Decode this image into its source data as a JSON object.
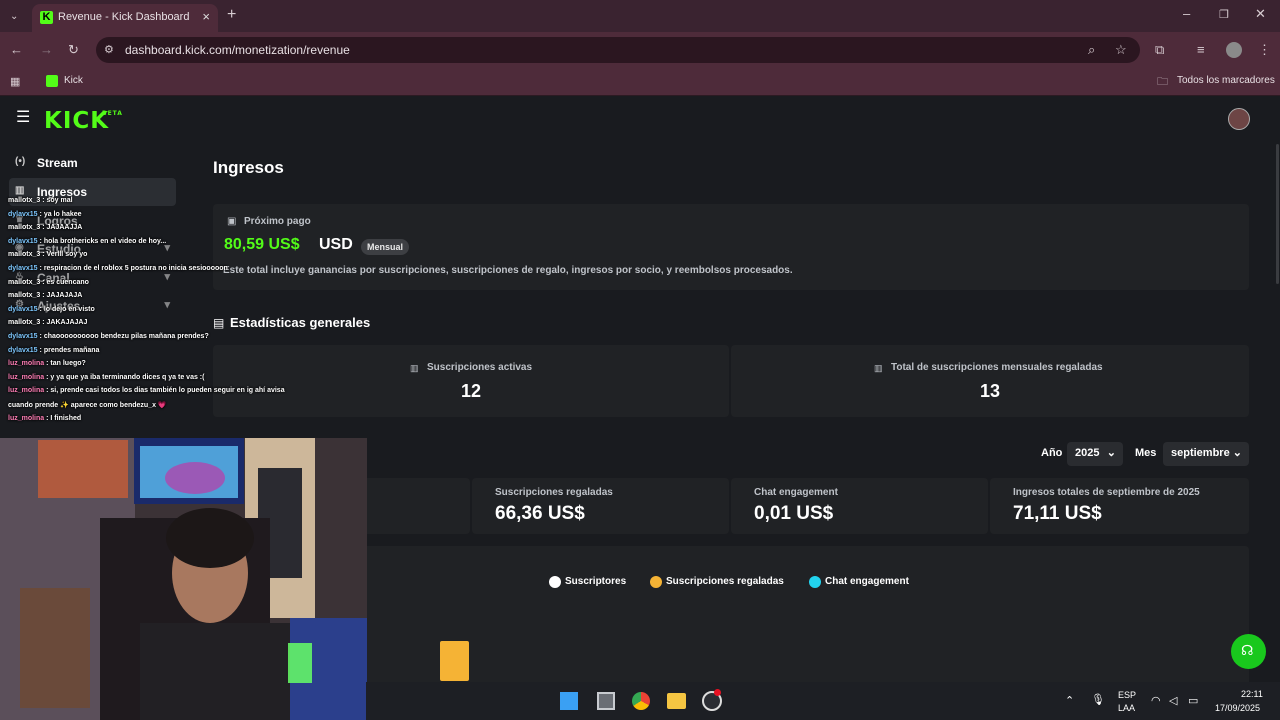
{
  "browser": {
    "tab_title": "Revenue - Kick Dashboard",
    "url": "dashboard.kick.com/monetization/revenue",
    "bookmark": "Kick",
    "all_bookmarks": "Todos los marcadores"
  },
  "app": {
    "logo": "KICK",
    "logo_badge": "BETA"
  },
  "sidebar": {
    "items": [
      {
        "label": "Stream",
        "icon": "broadcast-icon"
      },
      {
        "label": "Ingresos",
        "icon": "chart-icon",
        "active": true
      },
      {
        "label": "Logros",
        "icon": "trophy-icon"
      },
      {
        "label": "Estudio",
        "icon": "studio-icon"
      },
      {
        "label": "Canal",
        "icon": "channel-icon"
      },
      {
        "label": "Ajustes",
        "icon": "gear-icon"
      }
    ]
  },
  "main": {
    "title": "Ingresos",
    "next_payment": {
      "label": "Próximo pago",
      "amount": "80,59 US$",
      "currency": "USD",
      "badge": "Mensual",
      "note": "Este total incluye ganancias por suscripciones, suscripciones de regalo, ingresos por socio, y reembolsos procesados."
    },
    "general_stats_title": "Estadísticas generales",
    "stats": [
      {
        "label": "Suscripciones activas",
        "value": "12"
      },
      {
        "label": "Total de suscripciones mensuales regaladas",
        "value": "13"
      }
    ],
    "filters": {
      "year_label": "Año",
      "year_value": "2025",
      "month_label": "Mes",
      "month_value": "septiembre"
    },
    "revenue_cards": [
      {
        "label": "Suscripciones regaladas",
        "value": "66,36 US$"
      },
      {
        "label": "Chat engagement",
        "value": "0,01 US$"
      },
      {
        "label": "Ingresos totales de septiembre de 2025",
        "value": "71,11 US$"
      }
    ],
    "legend": [
      {
        "label": "Suscriptores",
        "color": "#ffffff"
      },
      {
        "label": "Suscripciones regaladas",
        "color": "#f5b335"
      },
      {
        "label": "Chat engagement",
        "color": "#22d3ee"
      }
    ]
  },
  "chat": [
    {
      "user": "mallotx_3",
      "text": ": soy mal",
      "color": "#ffffff"
    },
    {
      "user": "dylavx15",
      "text": ": ya lo hakee",
      "color": "#7ec8ff"
    },
    {
      "user": "mallotx_3",
      "text": ": JAJAAJJA",
      "color": "#ffffff"
    },
    {
      "user": "dylavx15",
      "text": ": hola brothericks en el video de hoy...",
      "color": "#7ec8ff"
    },
    {
      "user": "mallotx_3",
      "text": ": Verlll soy yo",
      "color": "#ffffff"
    },
    {
      "user": "dylavx15",
      "text": ": respiracion de el roblox 5 postura no inicia sesiooooon",
      "color": "#7ec8ff"
    },
    {
      "user": "mallotx_3",
      "text": ": es cuencano",
      "color": "#ffffff"
    },
    {
      "user": "mallotx_3",
      "text": ": JAJAJAJA",
      "color": "#ffffff"
    },
    {
      "user": "dylavx15",
      "text": ": lo dejo en visto",
      "color": "#7ec8ff"
    },
    {
      "user": "mallotx_3",
      "text": ": JAKAJAJAJ",
      "color": "#ffffff"
    },
    {
      "user": "dylavx15",
      "text": ": chaoooooooooo bendezu pilas mañana prendes?",
      "color": "#7ec8ff"
    },
    {
      "user": "dylavx15",
      "text": ": prendes mañana",
      "color": "#7ec8ff"
    },
    {
      "user": "luz_molina",
      "text": ": tan luego?",
      "color": "#ff7eb6"
    },
    {
      "user": "luz_molina",
      "text": ": y ya que ya iba terminando dices q ya te vas :(",
      "color": "#ff7eb6"
    },
    {
      "user": "luz_molina",
      "text": ": si, prende casi todos los dias también lo pueden seguir en ig ahí avisa",
      "color": "#ff7eb6"
    },
    {
      "user": "",
      "text": "cuando prende ✨ aparece como bendezu_x 💗",
      "color": "#ffffff"
    },
    {
      "user": "luz_molina",
      "text": ": I finished",
      "color": "#ff7eb6"
    }
  ],
  "taskbar": {
    "lang_top": "ESP",
    "lang_bottom": "LAA",
    "time": "22:11",
    "date": "17/09/2025"
  }
}
